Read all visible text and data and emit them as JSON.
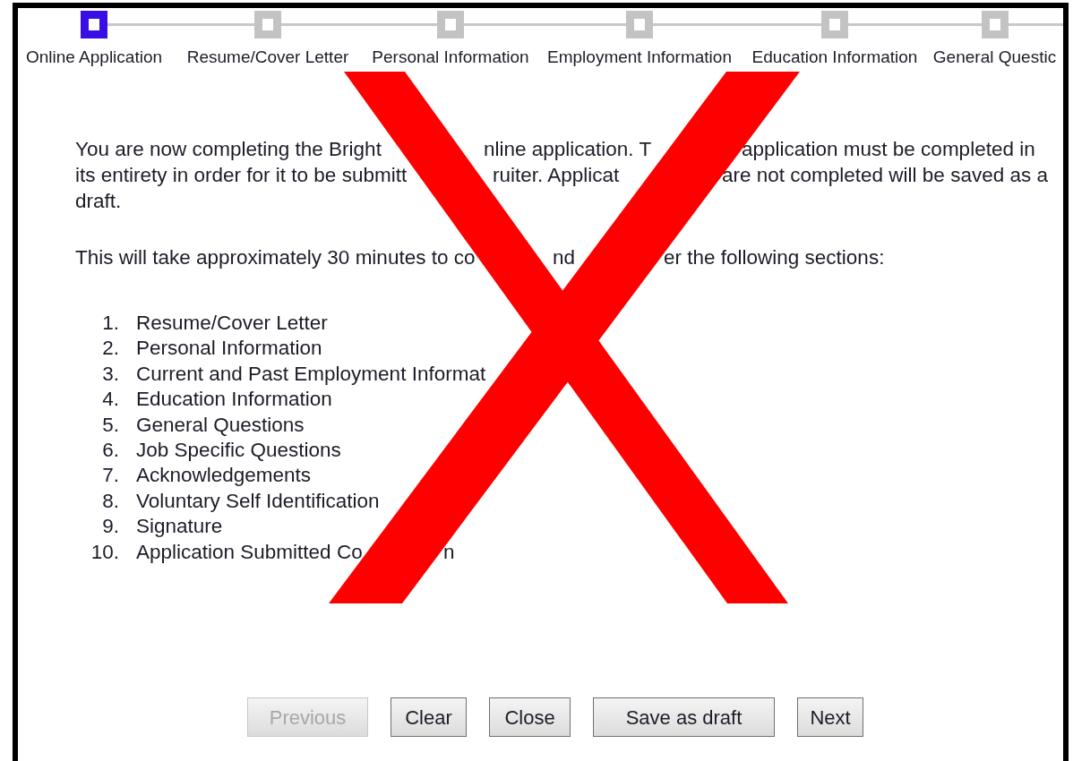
{
  "steps": [
    {
      "label": "Online Application",
      "selected": true
    },
    {
      "label": "Resume/Cover Letter",
      "selected": false
    },
    {
      "label": "Personal Information",
      "selected": false
    },
    {
      "label": "Employment Information",
      "selected": false
    },
    {
      "label": "Education Information",
      "selected": false
    },
    {
      "label": "General Questic",
      "selected": false
    }
  ],
  "intro_lines": [
    [
      "You are now completing the Bright",
      "nline application. T",
      "application must be completed in"
    ],
    [
      "its entirety in order for it to be submitt",
      "ruiter. Applicat",
      "are not completed will be saved as a"
    ],
    [
      "draft."
    ]
  ],
  "duration_line": [
    "This will take approximately 30 minutes to co",
    "nd",
    "er the following sections:"
  ],
  "sections": [
    {
      "number": "1.",
      "parts": [
        "Resume/Cover Letter"
      ]
    },
    {
      "number": "2.",
      "parts": [
        "Personal Information"
      ]
    },
    {
      "number": "3.",
      "parts": [
        "Current and Past Employment Informat"
      ]
    },
    {
      "number": "4.",
      "parts": [
        "Education Information"
      ]
    },
    {
      "number": "5.",
      "parts": [
        "General Questions"
      ]
    },
    {
      "number": "6.",
      "parts": [
        "Job Specific Questions"
      ]
    },
    {
      "number": "7.",
      "parts": [
        "Acknowledgements"
      ]
    },
    {
      "number": "8.",
      "parts": [
        "Voluntary Self Identification"
      ]
    },
    {
      "number": "9.",
      "parts": [
        "Signature"
      ]
    },
    {
      "number": "10.",
      "parts": [
        "Application Submitted Co",
        "n"
      ]
    }
  ],
  "buttons": [
    {
      "label": "Previous",
      "disabled": true
    },
    {
      "label": "Clear",
      "disabled": false
    },
    {
      "label": "Close",
      "disabled": false
    },
    {
      "label": "Save as draft",
      "disabled": false
    },
    {
      "label": "Next",
      "disabled": false
    }
  ]
}
